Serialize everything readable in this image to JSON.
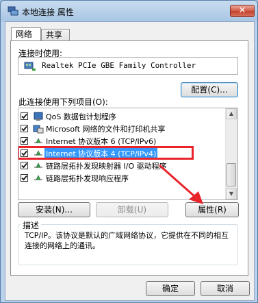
{
  "window": {
    "title": "本地连接 属性",
    "close_symbol": "✕"
  },
  "tabs": [
    {
      "label": "网络",
      "active": true
    },
    {
      "label": "共享",
      "active": false
    }
  ],
  "connect_using_label": "连接时使用:",
  "adapter_name": "Realtek PCIe GBE Family Controller",
  "configure_button": "配置(C)...",
  "items_label": "此连接使用下列项目(O):",
  "items": [
    {
      "label": "QoS 数据包计划程序",
      "checked": true,
      "icon": "qos-icon"
    },
    {
      "label": "Microsoft 网络的文件和打印机共享",
      "checked": true,
      "icon": "file-printer-share-icon"
    },
    {
      "label": "Internet 协议版本 6 (TCP/IPv6)",
      "checked": true,
      "icon": "protocol-icon"
    },
    {
      "label": "Internet 协议版本 4 (TCP/IPv4)",
      "checked": true,
      "icon": "protocol-icon",
      "selected": true
    },
    {
      "label": "链路层拓扑发现映射器 I/O 驱动程序",
      "checked": true,
      "icon": "protocol-icon"
    },
    {
      "label": "链路层拓扑发现响应程序",
      "checked": true,
      "icon": "protocol-icon"
    }
  ],
  "buttons": {
    "install": "安装(N)...",
    "uninstall": "卸载(U)",
    "properties": "属性(R)",
    "ok": "确定",
    "cancel": "取消"
  },
  "description": {
    "legend": "描述",
    "text": "TCP/IP。该协议是默认的广域网络协议，它提供在不同的相互连接的网络上的通讯。"
  },
  "colors": {
    "highlight": "#e8232a",
    "selection": "#3399ff"
  }
}
